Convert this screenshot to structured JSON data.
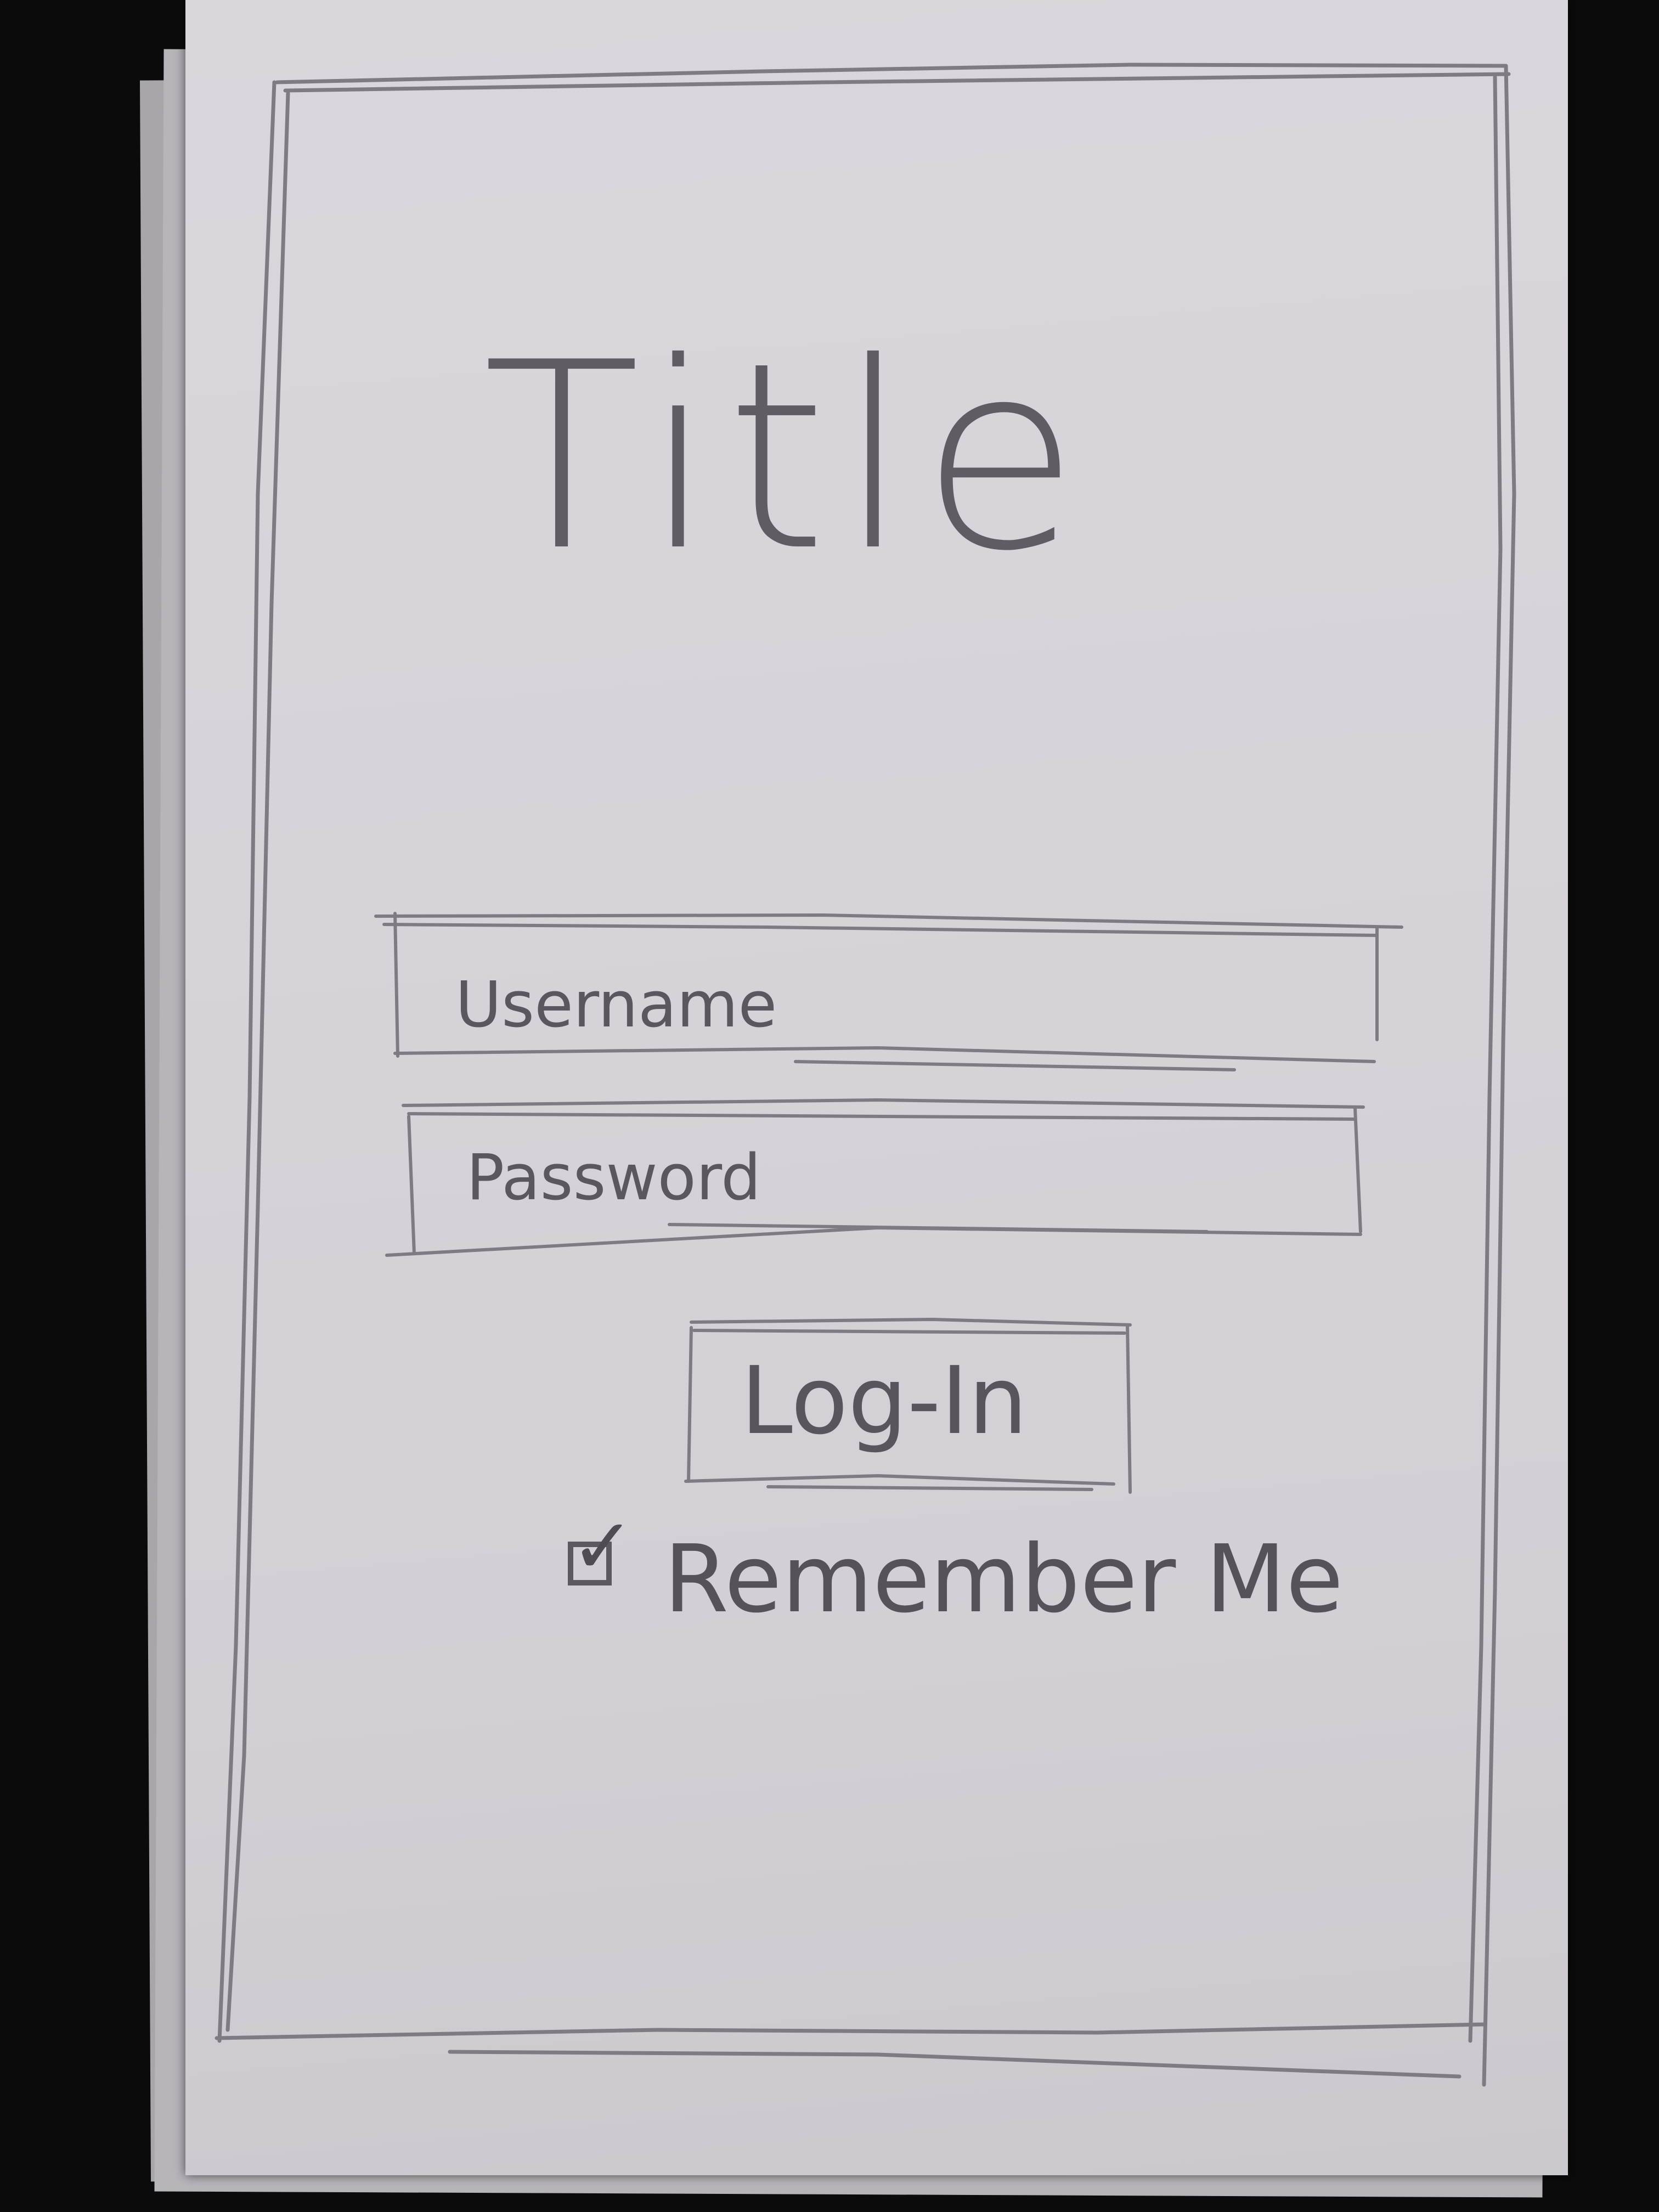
{
  "sketch": {
    "title": "Title",
    "username_placeholder": "Username",
    "password_placeholder": "Password",
    "login_label": "Log-In",
    "remember_label": "Remember Me",
    "remember_checked": true
  },
  "colors": {
    "background": "#0b0b0b",
    "paper": "#d6d3d9",
    "pencil": "#7e7c82"
  }
}
